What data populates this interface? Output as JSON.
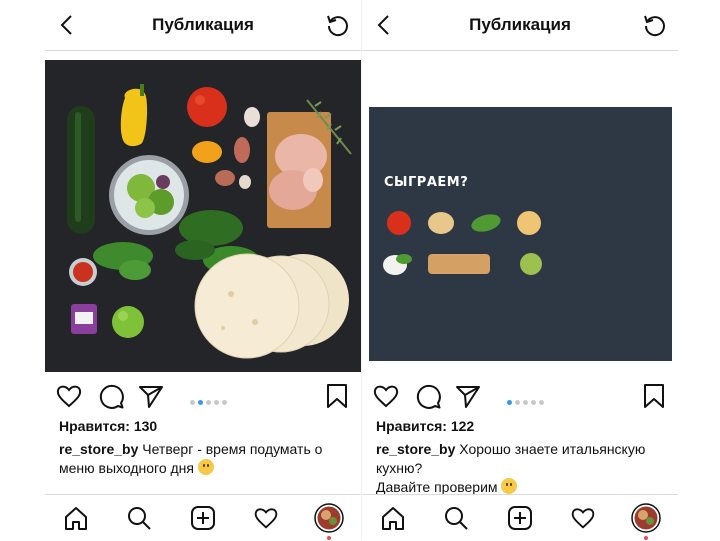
{
  "left": {
    "header_title": "Публикация",
    "likes": "Нравится: 130",
    "username": "re_store_by",
    "caption_text": "Четверг - время подумать о меню выходного дня"
  },
  "right": {
    "header_title": "Публикация",
    "likes": "Нравится: 122",
    "username": "re_store_by",
    "caption_text": "Хорошо знаете итальянскую кухню?",
    "caption_line2": "Давайте проверим",
    "image_text": "СЫГРАЕМ?"
  },
  "icons": {
    "back": "back-icon",
    "refresh": "refresh-icon",
    "like": "heart-icon",
    "comment": "comment-icon",
    "share": "share-icon",
    "save": "bookmark-icon",
    "home": "home-icon",
    "search": "search-icon",
    "add": "add-icon",
    "activity": "heart-icon",
    "profile": "avatar"
  },
  "colors": {
    "dot_active": "#3897f0",
    "notification": "#ed4956",
    "card_bg": "#2e3845"
  }
}
